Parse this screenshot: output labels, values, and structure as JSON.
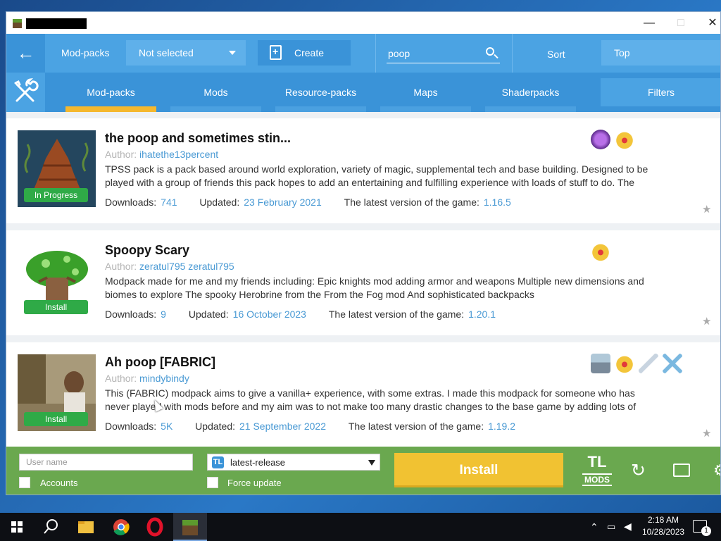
{
  "window": {
    "controls": {
      "minimize": "—",
      "maximize": "□",
      "close": "✕"
    }
  },
  "toolbar": {
    "back_icon": "arrow-left-icon",
    "modpacks_label": "Mod-packs",
    "modpack_select": "Not selected",
    "create_label": "Create",
    "search_value": "poop",
    "sort_label": "Sort",
    "sort_select": "Top"
  },
  "tabs": [
    {
      "label": "Mod-packs",
      "active": true
    },
    {
      "label": "Mods",
      "active": false
    },
    {
      "label": "Resource-packs",
      "active": false
    },
    {
      "label": "Maps",
      "active": false
    },
    {
      "label": "Shaderpacks",
      "active": false
    }
  ],
  "filters_label": "Filters",
  "items": [
    {
      "title": "the poop and sometimes stin...",
      "author_label": "Author:",
      "author": "ihatethe13percent",
      "description": "TPSS pack is a pack based around world exploration, variety of magic, supplemental tech and base building. Designed to be played with a group of friends this pack hopes to add an entertaining and fulfilling experience with loads of stuff to do. The",
      "downloads_label": "Downloads:",
      "downloads": "741",
      "updated_label": "Updated:",
      "updated": "23 February 2021",
      "version_label": "The latest version of the game:",
      "version": "1.16.5",
      "status": "In Progress",
      "categories": [
        "magic-orb-icon",
        "crown-icon"
      ]
    },
    {
      "title": "Spoopy Scary",
      "author_label": "Author:",
      "author": "zeratul795 zeratul795",
      "description": "Modpack made for me and my friends including: Epic knights mod adding armor and weapons Multiple new dimensions and biomes to explore The spooky Herobrine from the From the Fog mod And sophisticated backpacks",
      "downloads_label": "Downloads:",
      "downloads": "9",
      "updated_label": "Updated:",
      "updated": "16 October 2023",
      "version_label": "The latest version of the game:",
      "version": "1.20.1",
      "status": "Install",
      "categories": [
        "crown-icon"
      ]
    },
    {
      "title": "Ah poop [FABRIC]",
      "author_label": "Author:",
      "author": "mindybindy",
      "description": "This (FABRIC) modpack aims to give a vanilla+ experience, with some extras. I made this modpack for someone who has never played with mods before and my aim was to not make too many drastic changes to the base game by adding lots of",
      "downloads_label": "Downloads:",
      "downloads": "5K",
      "updated_label": "Updated:",
      "updated": "21 September 2022",
      "version_label": "The latest version of the game:",
      "version": "1.19.2",
      "status": "Install",
      "categories": [
        "knight-icon",
        "crown-icon",
        "sword-icon",
        "crossed-swords-icon"
      ]
    }
  ],
  "bottom": {
    "username_placeholder": "User name",
    "accounts_label": "Accounts",
    "version_select": "latest-release",
    "force_update_label": "Force update",
    "install_label": "Install",
    "logo_top": "TL",
    "logo_bottom": "MODS"
  },
  "taskbar": {
    "time": "2:18 AM",
    "date": "10/28/2023",
    "notifications": "1"
  },
  "colors": {
    "toolbar": "#4ba3e3",
    "tabbar": "#3a93d8",
    "active_tab": "#f5b82e",
    "bottom": "#6aa84f",
    "install": "#f1c232",
    "link": "#4a9ad4"
  }
}
